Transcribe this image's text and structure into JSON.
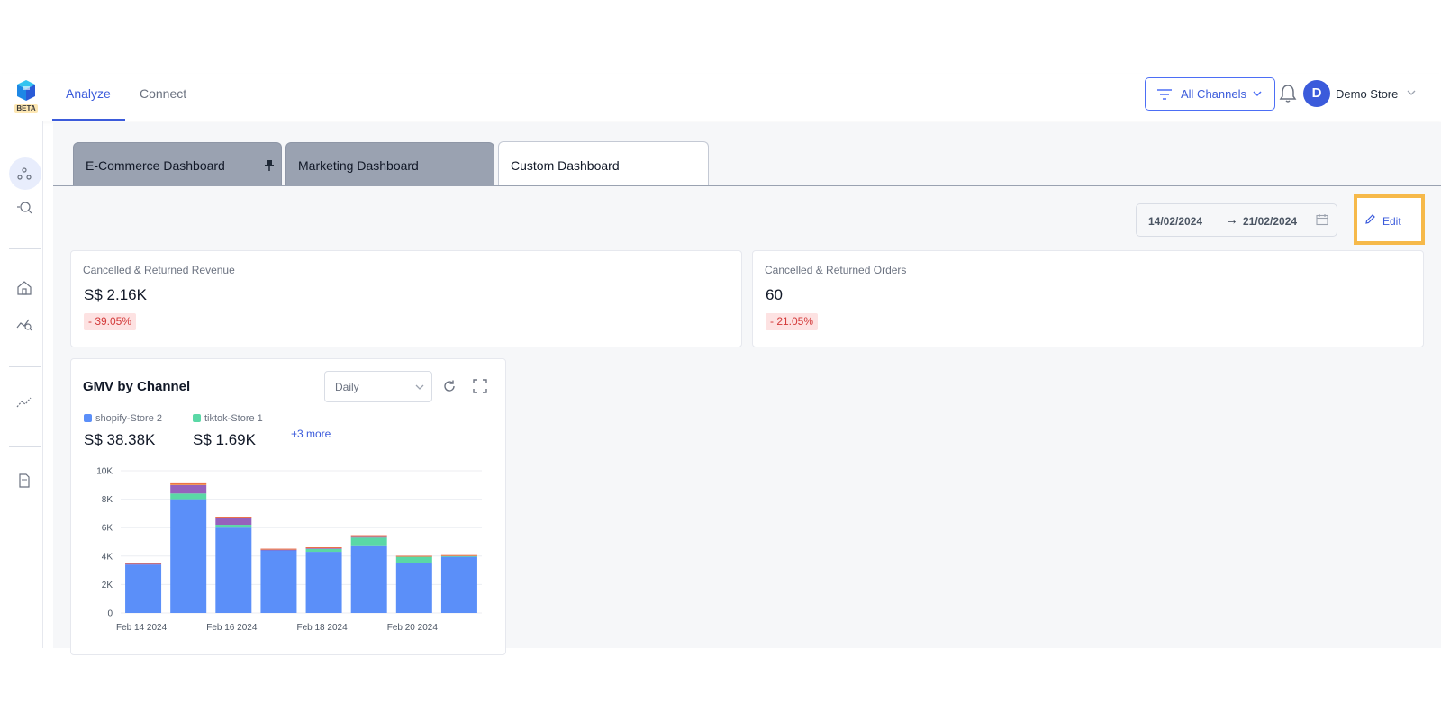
{
  "header": {
    "beta_badge": "BETA",
    "nav_tabs": [
      {
        "label": "Analyze",
        "active": true
      },
      {
        "label": "Connect",
        "active": false
      }
    ],
    "channels_button": "All Channels",
    "avatar_initial": "D",
    "store_name": "Demo Store"
  },
  "dashboard_tabs": [
    {
      "label": "E-Commerce Dashboard",
      "pinned": true
    },
    {
      "label": "Marketing Dashboard"
    },
    {
      "label": "Custom Dashboard",
      "active": true
    }
  ],
  "toolbar": {
    "date_from": "14/02/2024",
    "date_arrow": "→",
    "date_to": "21/02/2024",
    "edit_label": "Edit"
  },
  "kpi_cards": [
    {
      "title": "Cancelled & Returned Revenue",
      "value": "S$ 2.16K",
      "change": "- 39.05%"
    },
    {
      "title": "Cancelled & Returned Orders",
      "value": "60",
      "change": "- 21.05%"
    }
  ],
  "gmv_widget": {
    "title": "GMV by Channel",
    "granularity": "Daily",
    "legend": [
      {
        "name": "shopify-Store 2",
        "value": "S$ 38.38K",
        "color": "#5b8ff9"
      },
      {
        "name": "tiktok-Store 1",
        "value": "S$ 1.69K",
        "color": "#5ad8a6"
      }
    ],
    "more_label": "+3 more"
  },
  "chart_data": {
    "type": "bar",
    "stacked": true,
    "categories": [
      "Feb 14 2024",
      "Feb 15 2024",
      "Feb 16 2024",
      "Feb 17 2024",
      "Feb 18 2024",
      "Feb 19 2024",
      "Feb 20 2024",
      "Feb 21 2024"
    ],
    "x_tick_labels": [
      "Feb 14 2024",
      "",
      "Feb 16 2024",
      "",
      "Feb 18 2024",
      "",
      "Feb 20 2024",
      ""
    ],
    "series": [
      {
        "name": "shopify-Store 2",
        "color": "#5b8ff9",
        "values": [
          3400,
          8000,
          6000,
          4400,
          4300,
          4700,
          3500,
          3950
        ]
      },
      {
        "name": "tiktok-Store 1",
        "color": "#5ad8a6",
        "values": [
          0,
          400,
          200,
          0,
          200,
          600,
          450,
          50
        ]
      },
      {
        "color": "#9661bc",
        "values": [
          50,
          600,
          500,
          50,
          50,
          50,
          0,
          0
        ]
      },
      {
        "color": "#f6903d",
        "values": [
          50,
          100,
          50,
          50,
          50,
          100,
          50,
          50
        ]
      },
      {
        "color": "#e8684a",
        "values": [
          20,
          20,
          20,
          20,
          20,
          20,
          20,
          20
        ]
      }
    ],
    "y_ticks": [
      "0",
      "2K",
      "4K",
      "6K",
      "8K",
      "10K"
    ],
    "ylim": [
      0,
      10000
    ],
    "grid": true
  }
}
